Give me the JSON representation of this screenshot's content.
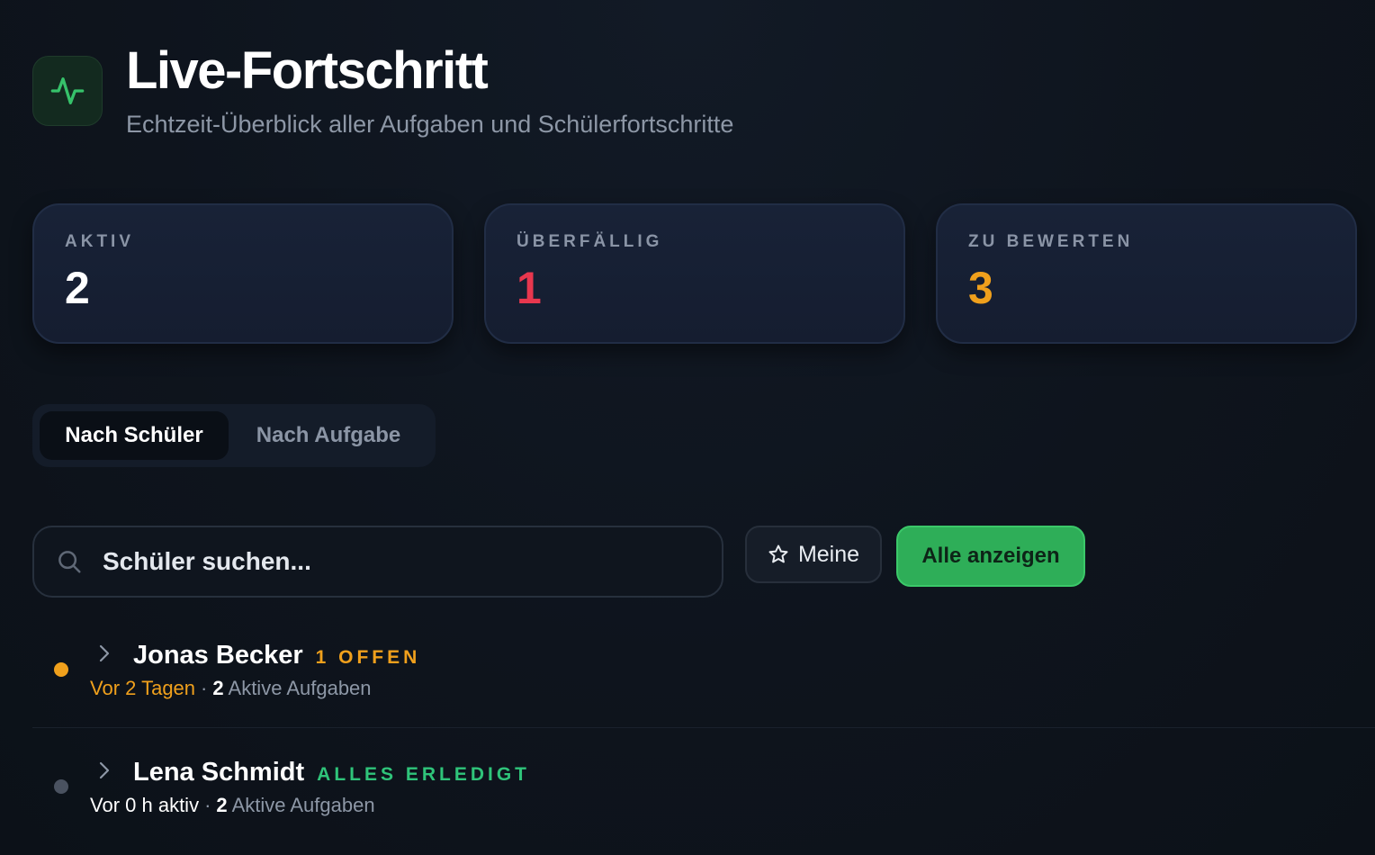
{
  "header": {
    "icon": "activity-icon",
    "title": "Live-Fortschritt",
    "subtitle": "Echtzeit-Überblick aller Aufgaben und Schülerfortschritte"
  },
  "stats": [
    {
      "label": "AKTIV",
      "value": "2",
      "color": "#ffffff"
    },
    {
      "label": "ÜBERFÄLLIG",
      "value": "1",
      "color": "#e8374e"
    },
    {
      "label": "ZU BEWERTEN",
      "value": "3",
      "color": "#f0a01c"
    }
  ],
  "tabs": {
    "by_student": "Nach Schüler",
    "by_task": "Nach Aufgabe",
    "active": "Nach Schüler"
  },
  "filter": {
    "search_placeholder": "Schüler suchen...",
    "search_icon": "search-icon",
    "mine_icon": "star-icon",
    "mine_label": "Meine",
    "show_all_label": "Alle anzeigen"
  },
  "students": [
    {
      "name": "Jonas Becker",
      "badge": "1 OFFEN",
      "badge_color": "#f0a01c",
      "dot_color": "#f0a01c",
      "last_seen": "Vor 2 Tagen",
      "last_seen_color": "#f0a01c",
      "active_count": "2",
      "active_label": "Aktive Aufgaben"
    },
    {
      "name": "Lena Schmidt",
      "badge": "ALLES ERLEDIGT",
      "badge_color": "#2fc47a",
      "dot_color": "#4a5260",
      "last_seen": "Vor 0 h aktiv",
      "last_seen_color": "#ffffff",
      "active_count": "2",
      "active_label": "Aktive Aufgaben"
    }
  ],
  "colors": {
    "accent_green": "#2eae58",
    "background": "#0e141d",
    "card": "#172033"
  }
}
